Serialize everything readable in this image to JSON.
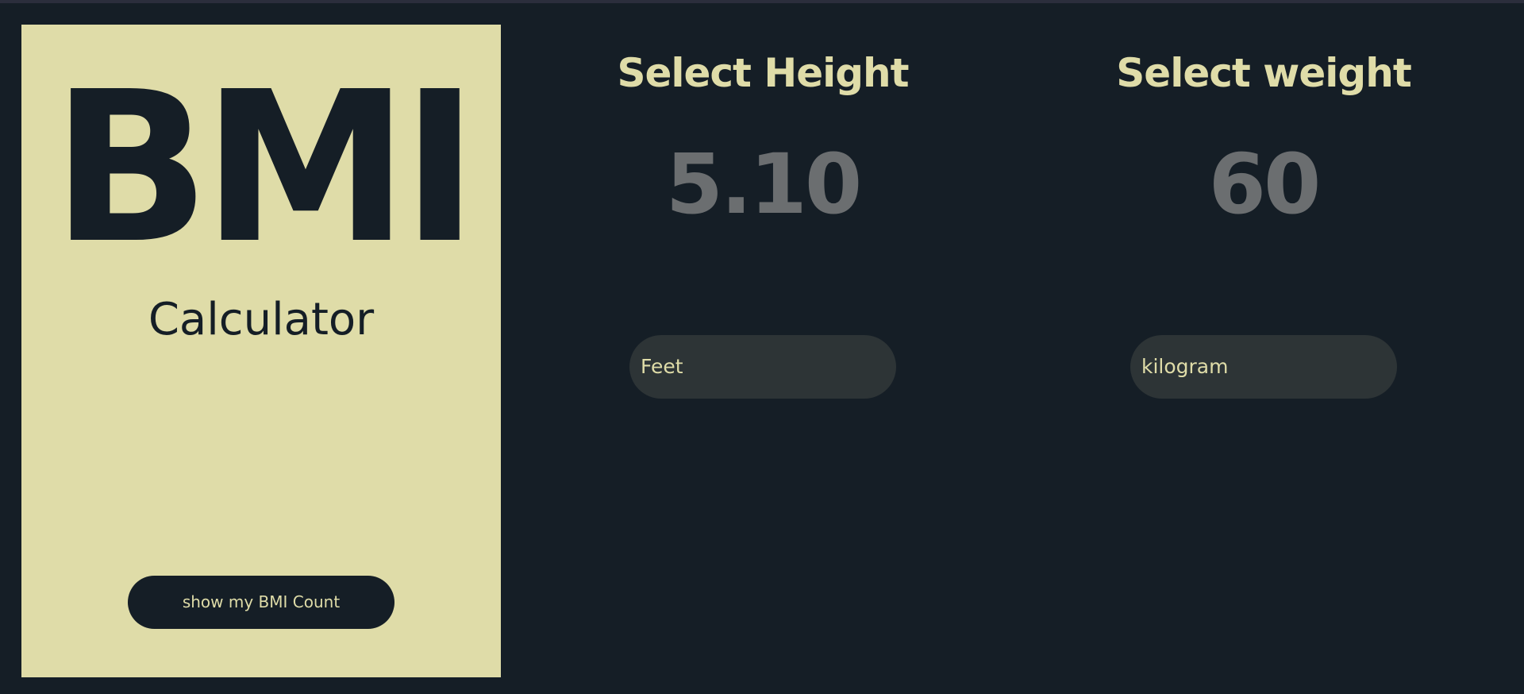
{
  "brand": {
    "title": "BMI",
    "subtitle": "Calculator"
  },
  "actions": {
    "show_button_label": "show my BMI Count"
  },
  "height": {
    "title": "Select Height",
    "value": "5.10",
    "unit": "Feet"
  },
  "weight": {
    "title": "Select weight",
    "value": "60",
    "unit": "kilogram"
  },
  "colors": {
    "background": "#151e26",
    "panel": "#dfdca8",
    "accent_text": "#dfdca8",
    "value_text": "#6b6e70",
    "field_bg": "#2d3436"
  }
}
